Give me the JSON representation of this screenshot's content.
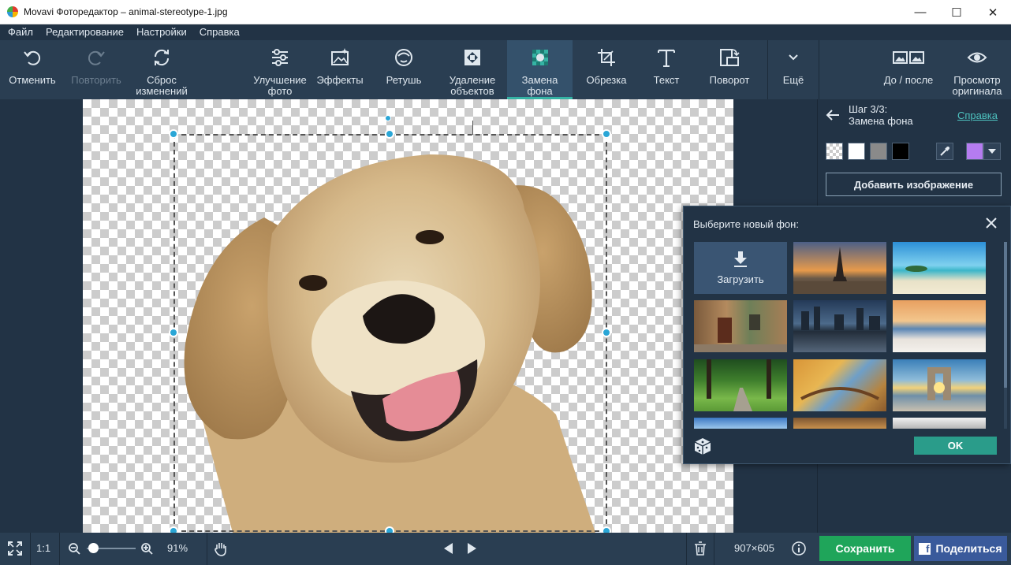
{
  "window": {
    "title": "Movavi Фоторедактор – animal-stereotype-1.jpg"
  },
  "menu": [
    "Файл",
    "Редактирование",
    "Настройки",
    "Справка"
  ],
  "toolbar": {
    "undo": "Отменить",
    "redo": "Повторить",
    "reset": "Сброс\nизменений",
    "enhance": "Улучшение\nфото",
    "effects": "Эффекты",
    "retouch": "Ретушь",
    "remove_objects": "Удаление\nобъектов",
    "replace_bg": "Замена\nфона",
    "crop": "Обрезка",
    "text": "Текст",
    "rotate": "Поворот",
    "more": "Ещё",
    "before_after": "До / после",
    "view_original": "Просмотр\nоригинала"
  },
  "panel": {
    "step": "Шаг 3/3:",
    "step_name": "Замена фона",
    "help": "Справка",
    "swatch_colors": [
      "#ffffff",
      "#8a8a8a",
      "#000000"
    ],
    "picked_color": "#b57cf0",
    "add_image": "Добавить изображение"
  },
  "popup": {
    "title": "Выберите новый фон:",
    "upload": "Загрузить",
    "backgrounds": [
      "paris-eiffel-tower",
      "tropical-beach",
      "old-street",
      "city-skyline",
      "seashore-sunset",
      "forest-path",
      "autumn-bridge",
      "seaside-lighthouse",
      "sky-meadow",
      "mountain-autumn"
    ],
    "ok": "OK"
  },
  "status": {
    "zoom_fit": "1:1",
    "zoom": "91%",
    "size": "907×605",
    "save": "Сохранить",
    "share": "Поделиться"
  },
  "colors": {
    "accent": "#35b3a4",
    "handle": "#2aa6d6",
    "save": "#1fa55a",
    "share": "#3a5a9b",
    "ok": "#2a9c8a"
  }
}
